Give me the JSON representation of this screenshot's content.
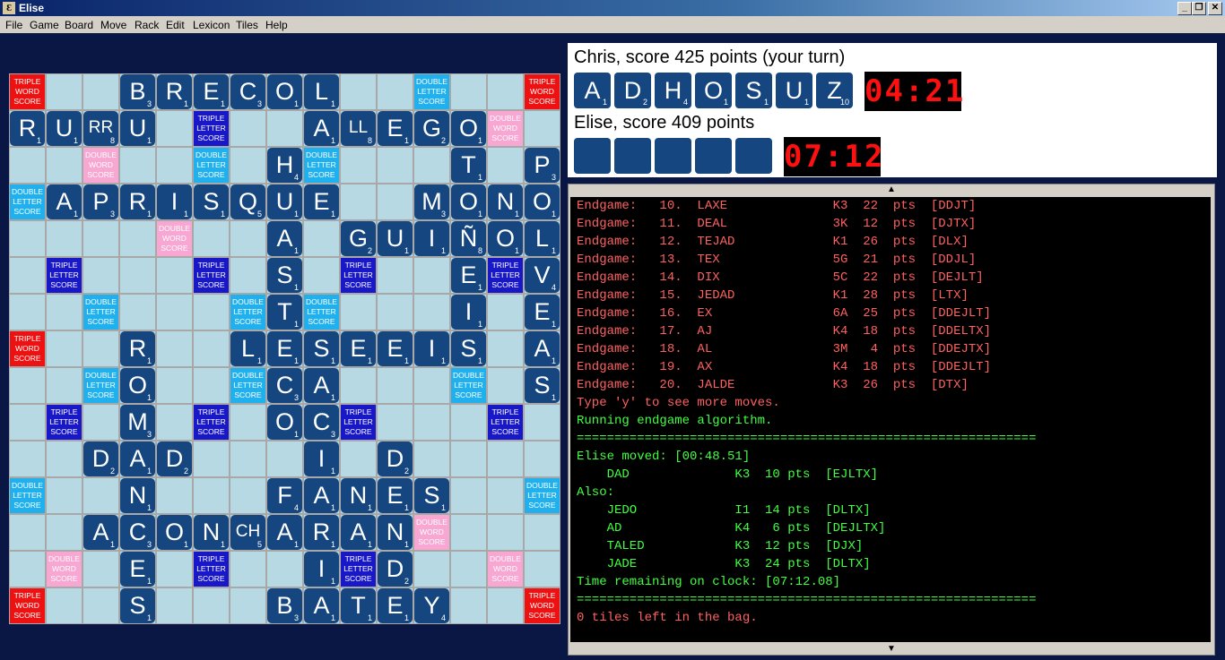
{
  "window": {
    "title": "Elise",
    "icon_glyph": "Ɛ",
    "min_label": "_",
    "restore_label": "❐",
    "close_label": "✕"
  },
  "menu": [
    "File",
    "Game",
    "Board",
    "Move",
    "Rack",
    "Edit",
    "Lexicon",
    "Tiles",
    "Help"
  ],
  "premium_labels": {
    "TW": "Triple Word Score",
    "DW": "Double Word Score",
    "TL": "Triple Letter Score",
    "DL": "Double Letter Score"
  },
  "board": {
    "premium_rows": [
      "TW N N N N N N N N N N DL N N TW",
      "N N N N N TL N N N N N N N DW N",
      "N N DW N N DL N N DL N N N N N N",
      "DL N N N N N N N N N N N N N N",
      "N N N N DW N N N N N N N N N N",
      "N TL N N N TL N N N TL N N N TL N",
      "N N DL N N N DL N DL N N N N N N",
      "TW N N N N N N N N N N N N N N",
      "N N DL N N N DL N N N N N DL N N",
      "N TL N N N TL N N N TL N N N TL N",
      "N N N N N N N N N N N N N N N",
      "DL N N N N N N N N N N N N N DL",
      "N N N N N N N N N N N DW N N N",
      "N DW N N N TL N N N TL N N N DW N",
      "TW N N N N N N N N N N N N N TW"
    ],
    "tiles": [
      {
        "r": 0,
        "c": 3,
        "l": "B",
        "p": "3"
      },
      {
        "r": 0,
        "c": 4,
        "l": "R",
        "p": "1"
      },
      {
        "r": 0,
        "c": 5,
        "l": "E",
        "p": "1"
      },
      {
        "r": 0,
        "c": 6,
        "l": "C",
        "p": "3"
      },
      {
        "r": 0,
        "c": 7,
        "l": "O",
        "p": "1"
      },
      {
        "r": 0,
        "c": 8,
        "l": "L",
        "p": "1"
      },
      {
        "r": 1,
        "c": 0,
        "l": "R",
        "p": "1"
      },
      {
        "r": 1,
        "c": 1,
        "l": "U",
        "p": "1"
      },
      {
        "r": 1,
        "c": 2,
        "l": "RR",
        "p": "8"
      },
      {
        "r": 1,
        "c": 3,
        "l": "U",
        "p": "1"
      },
      {
        "r": 1,
        "c": 8,
        "l": "A",
        "p": "1"
      },
      {
        "r": 1,
        "c": 9,
        "l": "LL",
        "p": "8"
      },
      {
        "r": 1,
        "c": 10,
        "l": "E",
        "p": "1"
      },
      {
        "r": 1,
        "c": 11,
        "l": "G",
        "p": "2"
      },
      {
        "r": 1,
        "c": 12,
        "l": "O",
        "p": "1"
      },
      {
        "r": 2,
        "c": 7,
        "l": "H",
        "p": "4"
      },
      {
        "r": 2,
        "c": 12,
        "l": "T",
        "p": "1"
      },
      {
        "r": 2,
        "c": 14,
        "l": "P",
        "p": "3"
      },
      {
        "r": 3,
        "c": 1,
        "l": "A",
        "p": "1"
      },
      {
        "r": 3,
        "c": 2,
        "l": "P",
        "p": "3"
      },
      {
        "r": 3,
        "c": 3,
        "l": "R",
        "p": "1"
      },
      {
        "r": 3,
        "c": 4,
        "l": "I",
        "p": "1"
      },
      {
        "r": 3,
        "c": 5,
        "l": "S",
        "p": "1"
      },
      {
        "r": 3,
        "c": 6,
        "l": "Q",
        "p": "5"
      },
      {
        "r": 3,
        "c": 7,
        "l": "U",
        "p": "1"
      },
      {
        "r": 3,
        "c": 8,
        "l": "E",
        "p": "1"
      },
      {
        "r": 3,
        "c": 11,
        "l": "M",
        "p": "3"
      },
      {
        "r": 3,
        "c": 12,
        "l": "O",
        "p": "1"
      },
      {
        "r": 3,
        "c": 13,
        "l": "N",
        "p": "1"
      },
      {
        "r": 3,
        "c": 14,
        "l": "O",
        "p": "1"
      },
      {
        "r": 4,
        "c": 7,
        "l": "A",
        "p": "1"
      },
      {
        "r": 4,
        "c": 9,
        "l": "G",
        "p": "2"
      },
      {
        "r": 4,
        "c": 10,
        "l": "U",
        "p": "1"
      },
      {
        "r": 4,
        "c": 11,
        "l": "I",
        "p": "1"
      },
      {
        "r": 4,
        "c": 12,
        "l": "Ñ",
        "p": "8"
      },
      {
        "r": 4,
        "c": 13,
        "l": "O",
        "p": "1"
      },
      {
        "r": 4,
        "c": 14,
        "l": "L",
        "p": "1"
      },
      {
        "r": 5,
        "c": 7,
        "l": "S",
        "p": "1"
      },
      {
        "r": 5,
        "c": 12,
        "l": "E",
        "p": "1"
      },
      {
        "r": 5,
        "c": 14,
        "l": "V",
        "p": "4"
      },
      {
        "r": 6,
        "c": 7,
        "l": "T",
        "p": "1"
      },
      {
        "r": 6,
        "c": 12,
        "l": "I",
        "p": "1"
      },
      {
        "r": 6,
        "c": 14,
        "l": "E",
        "p": "1"
      },
      {
        "r": 7,
        "c": 3,
        "l": "R",
        "p": "1"
      },
      {
        "r": 7,
        "c": 6,
        "l": "L",
        "p": "1"
      },
      {
        "r": 7,
        "c": 7,
        "l": "E",
        "p": "1"
      },
      {
        "r": 7,
        "c": 8,
        "l": "S",
        "p": "1"
      },
      {
        "r": 7,
        "c": 9,
        "l": "E",
        "p": "1"
      },
      {
        "r": 7,
        "c": 10,
        "l": "E",
        "p": "1"
      },
      {
        "r": 7,
        "c": 11,
        "l": "I",
        "p": "1"
      },
      {
        "r": 7,
        "c": 12,
        "l": "S",
        "p": "1"
      },
      {
        "r": 7,
        "c": 14,
        "l": "A",
        "p": "1"
      },
      {
        "r": 8,
        "c": 3,
        "l": "O",
        "p": "1"
      },
      {
        "r": 8,
        "c": 7,
        "l": "C",
        "p": "3"
      },
      {
        "r": 8,
        "c": 8,
        "l": "A",
        "p": "1"
      },
      {
        "r": 8,
        "c": 14,
        "l": "S",
        "p": "1"
      },
      {
        "r": 9,
        "c": 3,
        "l": "M",
        "p": "3"
      },
      {
        "r": 9,
        "c": 7,
        "l": "O",
        "p": "1"
      },
      {
        "r": 9,
        "c": 8,
        "l": "C",
        "p": "3"
      },
      {
        "r": 10,
        "c": 2,
        "l": "D",
        "p": "2"
      },
      {
        "r": 10,
        "c": 3,
        "l": "A",
        "p": "1"
      },
      {
        "r": 10,
        "c": 4,
        "l": "D",
        "p": "2"
      },
      {
        "r": 10,
        "c": 8,
        "l": "I",
        "p": "1"
      },
      {
        "r": 10,
        "c": 10,
        "l": "D",
        "p": "2"
      },
      {
        "r": 11,
        "c": 3,
        "l": "N",
        "p": "1"
      },
      {
        "r": 11,
        "c": 7,
        "l": "F",
        "p": "4"
      },
      {
        "r": 11,
        "c": 8,
        "l": "A",
        "p": "1"
      },
      {
        "r": 11,
        "c": 9,
        "l": "N",
        "p": "1"
      },
      {
        "r": 11,
        "c": 10,
        "l": "E",
        "p": "1"
      },
      {
        "r": 11,
        "c": 11,
        "l": "S",
        "p": "1"
      },
      {
        "r": 12,
        "c": 2,
        "l": "A",
        "p": "1"
      },
      {
        "r": 12,
        "c": 3,
        "l": "C",
        "p": "3"
      },
      {
        "r": 12,
        "c": 4,
        "l": "O",
        "p": "1"
      },
      {
        "r": 12,
        "c": 5,
        "l": "N",
        "p": "1"
      },
      {
        "r": 12,
        "c": 6,
        "l": "CH",
        "p": "5"
      },
      {
        "r": 12,
        "c": 7,
        "l": "A",
        "p": "1"
      },
      {
        "r": 12,
        "c": 8,
        "l": "R",
        "p": "1"
      },
      {
        "r": 12,
        "c": 9,
        "l": "A",
        "p": "1"
      },
      {
        "r": 12,
        "c": 10,
        "l": "N",
        "p": "1"
      },
      {
        "r": 13,
        "c": 3,
        "l": "E",
        "p": "1"
      },
      {
        "r": 13,
        "c": 8,
        "l": "I",
        "p": "1"
      },
      {
        "r": 13,
        "c": 10,
        "l": "D",
        "p": "2"
      },
      {
        "r": 14,
        "c": 3,
        "l": "S",
        "p": "1"
      },
      {
        "r": 14,
        "c": 7,
        "l": "B",
        "p": "3"
      },
      {
        "r": 14,
        "c": 8,
        "l": "A",
        "p": "1"
      },
      {
        "r": 14,
        "c": 9,
        "l": "T",
        "p": "1"
      },
      {
        "r": 14,
        "c": 10,
        "l": "E",
        "p": "1"
      },
      {
        "r": 14,
        "c": 11,
        "l": "Y",
        "p": "4"
      }
    ]
  },
  "players": {
    "p1": {
      "label": "Chris, score 425 points (your turn)",
      "clock": "04:21",
      "rack": [
        {
          "l": "A",
          "p": "1"
        },
        {
          "l": "D",
          "p": "2"
        },
        {
          "l": "H",
          "p": "4"
        },
        {
          "l": "O",
          "p": "1"
        },
        {
          "l": "S",
          "p": "1"
        },
        {
          "l": "U",
          "p": "1"
        },
        {
          "l": "Z",
          "p": "10"
        }
      ]
    },
    "p2": {
      "label": "Elise, score 409 points",
      "clock": "07:12",
      "rack": [
        {
          "l": "",
          "p": ""
        },
        {
          "l": "",
          "p": ""
        },
        {
          "l": "",
          "p": ""
        },
        {
          "l": "",
          "p": ""
        },
        {
          "l": "",
          "p": ""
        }
      ]
    }
  },
  "log": {
    "scroll_up": "▲",
    "scroll_down": "▼",
    "lines": [
      {
        "t": "Endgame:   10.  LAXE              K3  22  pts  [DDJT]",
        "c": "red"
      },
      {
        "t": "Endgame:   11.  DEAL              3K  12  pts  [DJTX]",
        "c": "red"
      },
      {
        "t": "Endgame:   12.  TEJAD             K1  26  pts  [DLX]",
        "c": "red"
      },
      {
        "t": "Endgame:   13.  TEX               5G  21  pts  [DDJL]",
        "c": "red"
      },
      {
        "t": "Endgame:   14.  DIX               5C  22  pts  [DEJLT]",
        "c": "red"
      },
      {
        "t": "Endgame:   15.  JEDAD             K1  28  pts  [LTX]",
        "c": "red"
      },
      {
        "t": "Endgame:   16.  EX                6A  25  pts  [DDEJLT]",
        "c": "red"
      },
      {
        "t": "Endgame:   17.  AJ                K4  18  pts  [DDELTX]",
        "c": "red"
      },
      {
        "t": "Endgame:   18.  AL                3M   4  pts  [DDEJTX]",
        "c": "red"
      },
      {
        "t": "Endgame:   19.  AX                K4  18  pts  [DDEJLT]",
        "c": "red"
      },
      {
        "t": "Endgame:   20.  JALDE             K3  26  pts  [DTX]",
        "c": "red"
      },
      {
        "t": "Type 'y' to see more moves.",
        "c": "red"
      },
      {
        "t": "Running endgame algorithm.",
        "c": "grn"
      },
      {
        "t": "=============================================================",
        "c": "grn"
      },
      {
        "t": "Elise moved: [00:48.51]",
        "c": "grn"
      },
      {
        "t": "    DAD              K3  10 pts  [EJLTX]",
        "c": "grn"
      },
      {
        "t": "Also:",
        "c": "grn"
      },
      {
        "t": "    JEDO             I1  14 pts  [DLTX]",
        "c": "grn"
      },
      {
        "t": "    AD               K4   6 pts  [DEJLTX]",
        "c": "grn"
      },
      {
        "t": "    TALED            K3  12 pts  [DJX]",
        "c": "grn"
      },
      {
        "t": "    JADE             K3  24 pts  [DLTX]",
        "c": "grn"
      },
      {
        "t": "Time remaining on clock: [07:12.08]",
        "c": "grn"
      },
      {
        "t": "=============================================================",
        "c": "grn"
      },
      {
        "t": "0 tiles left in the bag.",
        "c": "red"
      }
    ]
  }
}
